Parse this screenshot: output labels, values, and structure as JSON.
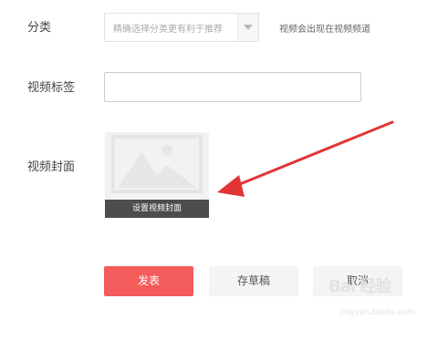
{
  "form": {
    "category": {
      "label": "分类",
      "placeholder": "精确选择分类更有利于推荐",
      "hint": "视频会出现在视频频道"
    },
    "tags": {
      "label": "视频标签",
      "value": ""
    },
    "cover": {
      "label": "视频封面",
      "button_label": "设置视频封面"
    }
  },
  "actions": {
    "publish_label": "发表",
    "draft_label": "存草稿",
    "cancel_label": "取消"
  },
  "watermark": {
    "brand": "Bai 经验",
    "url": "jingyan.baidu.com"
  },
  "colors": {
    "primary": "#f45b5b",
    "annotation_arrow": "#e23434",
    "secondary_button": "#f4f4f4"
  },
  "icons": {
    "cover_placeholder": "image-placeholder-icon",
    "select_arrow": "chevron-down-icon"
  }
}
